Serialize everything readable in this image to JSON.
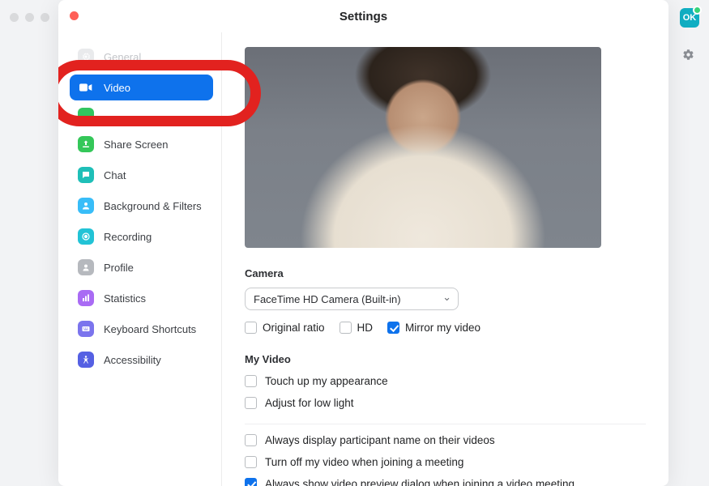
{
  "window": {
    "title": "Settings"
  },
  "userBadge": "OK",
  "sidebar": {
    "items": [
      {
        "id": "general",
        "label": "General",
        "color": "#b7bbc1",
        "icon": "gear"
      },
      {
        "id": "video",
        "label": "Video",
        "color": "#0e72ec",
        "icon": "video"
      },
      {
        "id": "audio",
        "label": "",
        "color": "#31c55f",
        "icon": "audio"
      },
      {
        "id": "share",
        "label": "Share Screen",
        "color": "#34c759",
        "icon": "share"
      },
      {
        "id": "chat",
        "label": "Chat",
        "color": "#1fbfb8",
        "icon": "chat"
      },
      {
        "id": "bgfilters",
        "label": "Background & Filters",
        "color": "#38bdf8",
        "icon": "person"
      },
      {
        "id": "recording",
        "label": "Recording",
        "color": "#22c3d6",
        "icon": "record"
      },
      {
        "id": "profile",
        "label": "Profile",
        "color": "#b6b9be",
        "icon": "profile"
      },
      {
        "id": "stats",
        "label": "Statistics",
        "color": "#a96bf4",
        "icon": "bars"
      },
      {
        "id": "shortcuts",
        "label": "Keyboard Shortcuts",
        "color": "#7b74ed",
        "icon": "keyboard"
      },
      {
        "id": "a11y",
        "label": "Accessibility",
        "color": "#5560e3",
        "icon": "a11y"
      }
    ],
    "active": "video"
  },
  "video": {
    "cameraSection": "Camera",
    "cameraSelected": "FaceTime HD Camera (Built-in)",
    "opts": {
      "originalRatio": {
        "label": "Original ratio",
        "checked": false
      },
      "hd": {
        "label": "HD",
        "checked": false
      },
      "mirror": {
        "label": "Mirror my video",
        "checked": true
      }
    },
    "myVideoSection": "My Video",
    "myVideo": {
      "touchUp": {
        "label": "Touch up my appearance",
        "checked": false
      },
      "lowLight": {
        "label": "Adjust for low light",
        "checked": false
      }
    },
    "meetingOpts": {
      "displayName": {
        "label": "Always display participant name on their videos",
        "checked": false
      },
      "turnOff": {
        "label": "Turn off my video when joining a meeting",
        "checked": false
      },
      "preview": {
        "label": "Always show video preview dialog when joining a video meeting",
        "checked": true
      }
    }
  }
}
